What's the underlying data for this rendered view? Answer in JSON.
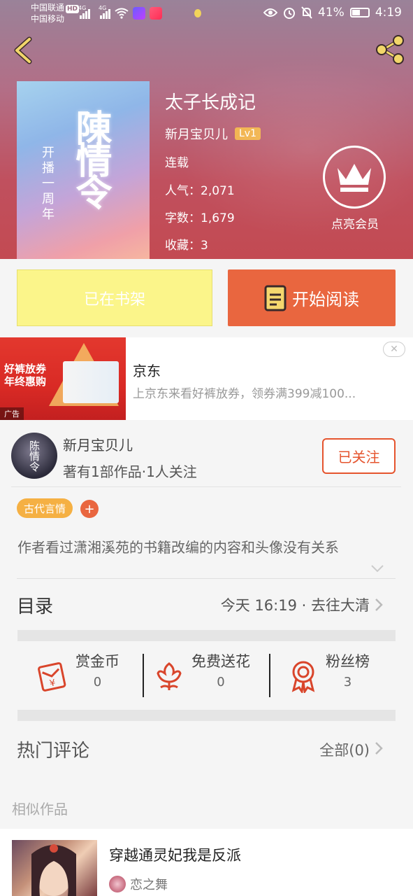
{
  "status_bar": {
    "carrier1": "中国联通",
    "hd": "HD",
    "carrier2": "中国移动",
    "net1": "4G",
    "net2": "4G",
    "battery_pct": "41%",
    "time": "4:19"
  },
  "book": {
    "title": "太子长成记",
    "author": "新月宝贝儿",
    "level": "Lv1",
    "status": "连载",
    "popularity": "人气：2,071",
    "word_count": "字数：1,679",
    "favorites": "收藏：3",
    "cover_title": "陳情令",
    "cover_sub": "开播一周年"
  },
  "vip": {
    "label": "点亮会员"
  },
  "actions": {
    "shelf_label": "已在书架",
    "read_label": "开始阅读"
  },
  "ad": {
    "image_promo": "好裤放券\n年终惠购",
    "badge": "广告",
    "title": "京东",
    "description": "上京东来看好裤放券，领券满399减100...",
    "close": "✕"
  },
  "author_card": {
    "name": "新月宝贝儿",
    "meta": "著有1部作品·1人关注",
    "follow_label": "已关注",
    "avatar_text": "陈情令"
  },
  "tags": {
    "genre": "古代言情",
    "add": "+"
  },
  "description": "作者看过潇湘溪苑的书籍改编的内容和头像没有关系",
  "catalog": {
    "label": "目录",
    "latest": "今天 16:19 · 去往大清"
  },
  "stats": [
    {
      "label": "赏金币",
      "value": "0"
    },
    {
      "label": "免费送花",
      "value": "0"
    },
    {
      "label": "粉丝榜",
      "value": "3"
    }
  ],
  "comments": {
    "label": "热门评论",
    "all": "全部(0)"
  },
  "similar": {
    "label": "相似作品",
    "items": [
      {
        "title": "穿越通灵妃我是反派",
        "author": "恋之舞"
      }
    ]
  },
  "colors": {
    "accent": "#e9663f",
    "shelf_button": "#fbf58a",
    "level_badge": "#f1b24a",
    "follow": "#e5542e",
    "icon_red": "#d9452b"
  }
}
